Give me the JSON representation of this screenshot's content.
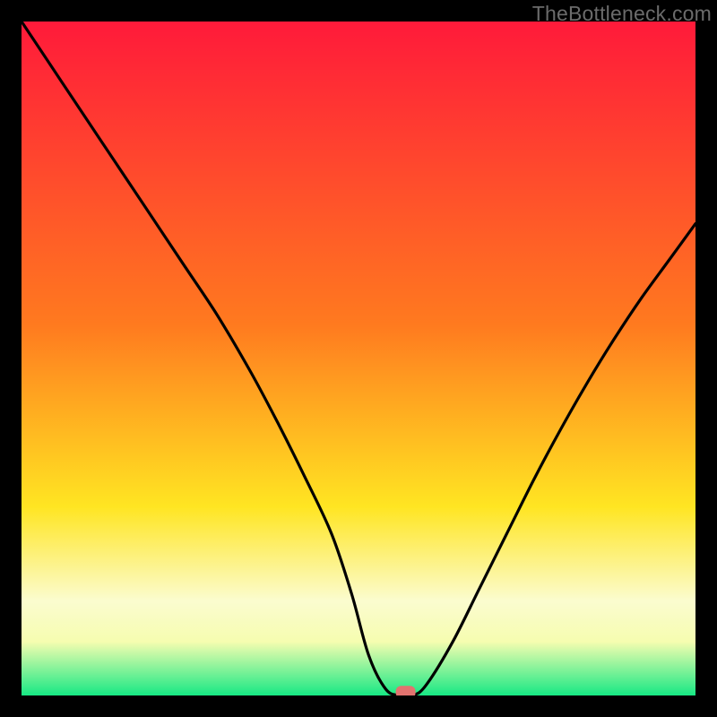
{
  "watermark": "TheBottleneck.com",
  "colors": {
    "bg": "#000000",
    "curve": "#000000",
    "marker": "#e2736f",
    "gradient_top": "#ff1a3a",
    "gradient_mid1": "#ff7a1f",
    "gradient_mid2": "#ffe522",
    "gradient_band_light": "#fbfccf",
    "gradient_bottom": "#17e884"
  },
  "chart_data": {
    "type": "line",
    "title": "",
    "xlabel": "",
    "ylabel": "",
    "xlim": [
      0,
      100
    ],
    "ylim": [
      0,
      100
    ],
    "grid": false,
    "legend": false,
    "series": [
      {
        "name": "bottleneck-curve",
        "x": [
          0,
          6,
          12,
          18,
          24,
          29,
          34,
          38,
          42,
          46,
          49,
          51.5,
          54,
          56,
          58,
          60,
          64,
          68,
          72,
          76,
          80,
          84,
          88,
          92,
          96,
          100
        ],
        "y": [
          100,
          91,
          82,
          73,
          64,
          56.5,
          48,
          40.5,
          32.5,
          24,
          15,
          6,
          1,
          0,
          0,
          1.5,
          8,
          16,
          24,
          32,
          39.5,
          46.5,
          53,
          59,
          64.5,
          70
        ]
      }
    ],
    "marker": {
      "x": 57,
      "y": 0.5,
      "shape": "rounded-rect",
      "color": "#e2736f"
    }
  }
}
